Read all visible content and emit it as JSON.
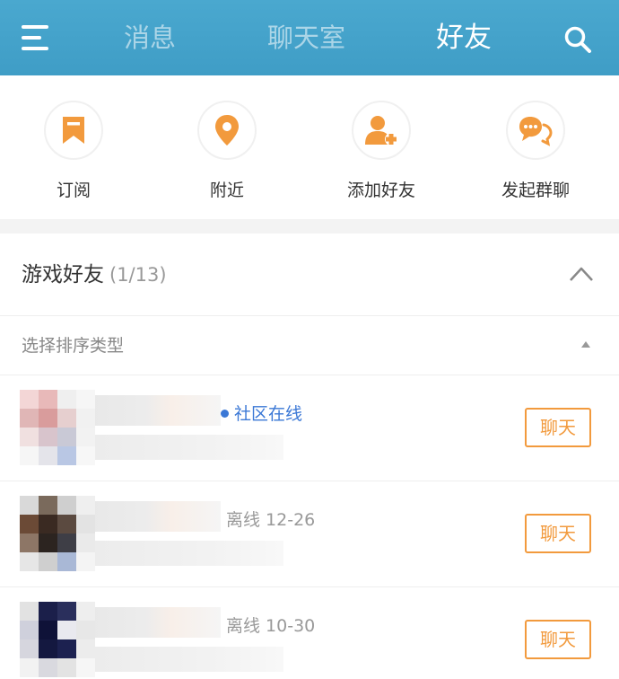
{
  "header": {
    "tabs": [
      {
        "label": "消息",
        "active": false
      },
      {
        "label": "聊天室",
        "active": false
      },
      {
        "label": "好友",
        "active": true
      }
    ],
    "menu_icon": "menu-icon",
    "search_icon": "search-icon",
    "color": "#3f9dc6"
  },
  "actions": [
    {
      "label": "订阅",
      "icon": "bookmark-icon"
    },
    {
      "label": "附近",
      "icon": "location-pin-icon"
    },
    {
      "label": "添加好友",
      "icon": "add-user-icon"
    },
    {
      "label": "发起群聊",
      "icon": "group-chat-icon"
    }
  ],
  "accent": "#f29a3d",
  "group": {
    "title": "游戏好友",
    "count": "(1/13)",
    "sort_label": "选择排序类型"
  },
  "friends": [
    {
      "status": "社区在线",
      "online": true,
      "chat_label": "聊天"
    },
    {
      "status": "离线 12-26",
      "online": false,
      "chat_label": "聊天"
    },
    {
      "status": "离线 10-30",
      "online": false,
      "chat_label": "聊天"
    }
  ]
}
